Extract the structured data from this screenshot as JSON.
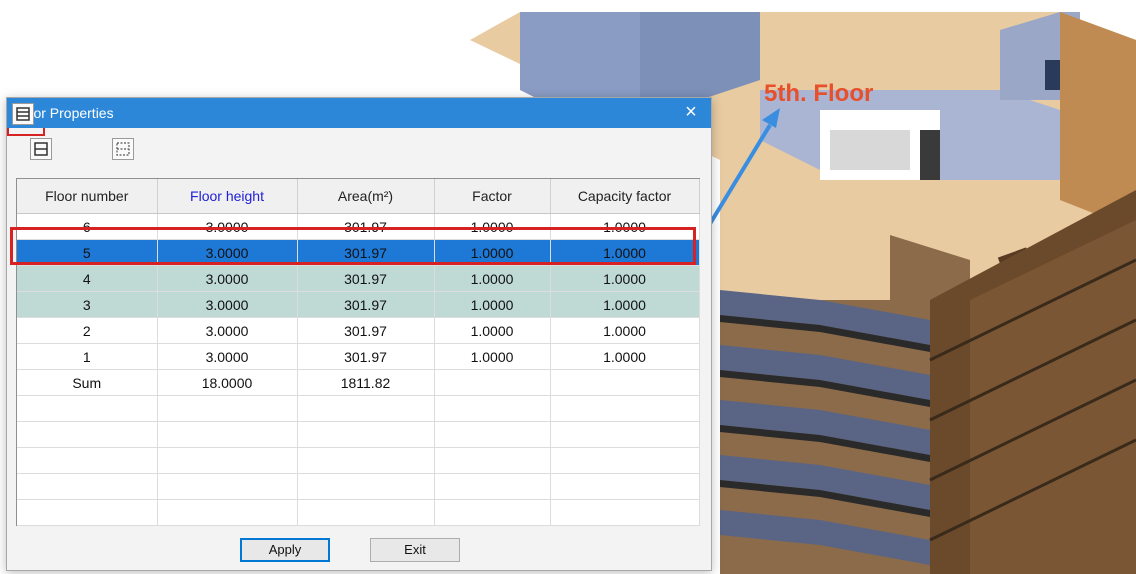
{
  "window": {
    "title": "Floor Properties",
    "close_glyph": "×"
  },
  "toolbar": {
    "icons": [
      "floor-single-icon",
      "floor-split-icon",
      "floor-dashed-icon"
    ]
  },
  "table": {
    "columns": [
      "Floor number",
      "Floor height",
      "Area(m²)",
      "Factor",
      "Capacity factor"
    ],
    "rows": [
      {
        "floor": "6",
        "height": "3.0000",
        "area": "301.97",
        "factor": "1.0000",
        "capacity": "1.0000"
      },
      {
        "floor": "5",
        "height": "3.0000",
        "area": "301.97",
        "factor": "1.0000",
        "capacity": "1.0000"
      },
      {
        "floor": "4",
        "height": "3.0000",
        "area": "301.97",
        "factor": "1.0000",
        "capacity": "1.0000"
      },
      {
        "floor": "3",
        "height": "3.0000",
        "area": "301.97",
        "factor": "1.0000",
        "capacity": "1.0000"
      },
      {
        "floor": "2",
        "height": "3.0000",
        "area": "301.97",
        "factor": "1.0000",
        "capacity": "1.0000"
      },
      {
        "floor": "1",
        "height": "3.0000",
        "area": "301.97",
        "factor": "1.0000",
        "capacity": "1.0000"
      },
      {
        "floor": "Sum",
        "height": "18.0000",
        "area": "1811.82",
        "factor": "",
        "capacity": ""
      }
    ]
  },
  "buttons": {
    "apply": "Apply",
    "exit": "Exit"
  },
  "annotation": {
    "callout": "5th. Floor"
  },
  "colors": {
    "titlebar": "#2d87d8",
    "selected_row": "#1e78d6",
    "teal_row": "#bfd9d5",
    "highlight_frame": "#d62222",
    "callout": "#e8502a"
  }
}
